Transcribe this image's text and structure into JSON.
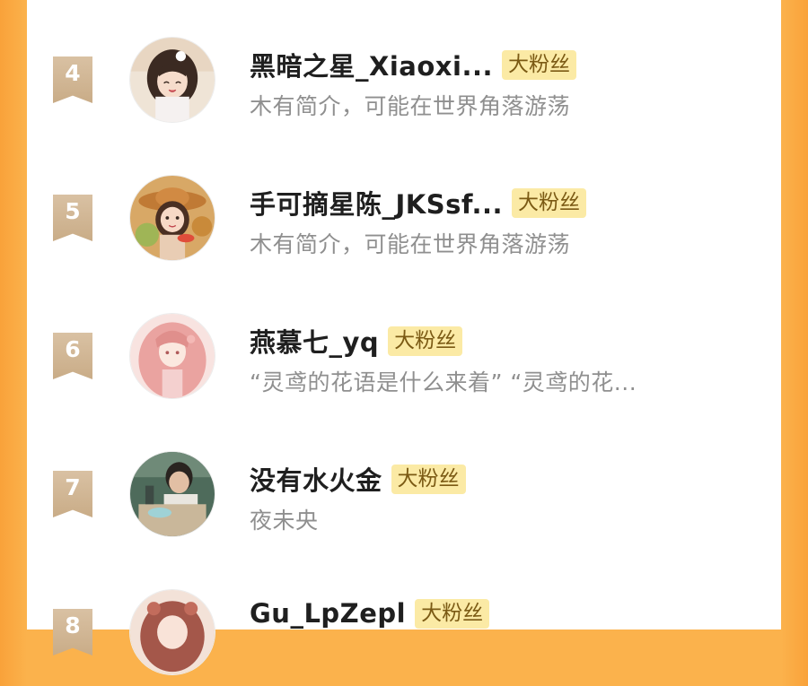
{
  "badge_label": "大粉丝",
  "rows": [
    {
      "rank": "4",
      "name": "黑暗之星_Xiaoxi...",
      "bio": "木有简介，可能在世界角落游荡",
      "avatar_icon": "girl-avatar-icon"
    },
    {
      "rank": "5",
      "name": "手可摘星陈_JKSsf...",
      "bio": "木有简介，可能在世界角落游荡",
      "avatar_icon": "girl-straw-hat-avatar-icon"
    },
    {
      "rank": "6",
      "name": "燕慕七_yq",
      "bio": "“灵鸢的花语是什么来着” “灵鸢的花...",
      "avatar_icon": "pink-hair-avatar-icon"
    },
    {
      "rank": "7",
      "name": "没有水火金",
      "bio": "夜未央",
      "avatar_icon": "boy-photo-avatar-icon"
    },
    {
      "rank": "8",
      "name": "Gu_LpZepl",
      "bio": "",
      "avatar_icon": "brown-hair-avatar-icon"
    }
  ],
  "colors": {
    "background": "#fbb24c",
    "badge_bg": "#fbeaa5",
    "rank_tag": "#d2b894"
  }
}
